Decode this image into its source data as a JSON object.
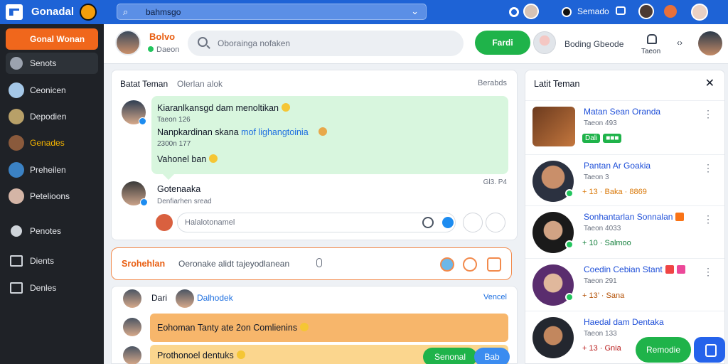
{
  "topbar": {
    "app_name": "Gonadal",
    "search_text": "bahmsgo",
    "user_label": "Semado"
  },
  "sidebar": {
    "items": [
      {
        "label": "Gonal Wonan"
      },
      {
        "label": "Senots"
      },
      {
        "label": "Ceonicen"
      },
      {
        "label": "Depodien"
      },
      {
        "label": "Genades"
      },
      {
        "label": "Preheilen"
      },
      {
        "label": "Petelioons"
      },
      {
        "label": "Penotes"
      },
      {
        "label": "Dients"
      },
      {
        "label": "Denles"
      }
    ]
  },
  "header": {
    "user_name": "Bolvo",
    "user_status": "Daeon",
    "search_placeholder": "Oborainga nofaken",
    "action_button": "Fardi",
    "contact_label": "Boding Gbeode",
    "lock_label": "Taeon",
    "more_label": "‹›"
  },
  "chat": {
    "title": "Batat Teman",
    "subtitle": "Olerlan alok",
    "right_label": "Berabds",
    "line1": "Kiaranlkansgd dam menoltikan",
    "line1_meta": "Taeon 126",
    "line2_prefix": "Nanpkardinan skana ",
    "line2_link": "mof lighangtoinia",
    "line2_meta": "2300n 177",
    "line3": "Vahonel ban",
    "time": "Gl3. P4",
    "user2_name": "Gotenaaka",
    "user2_sub": "Denfiarhen sread",
    "reply_placeholder": "Halalotonamel"
  },
  "compose": {
    "label": "Srohehlan",
    "placeholder": "Oeronake alidt tajeyodlanean"
  },
  "feed": {
    "label1": "Dari",
    "label2": "Dalhodek",
    "right_label": "Vencel",
    "bar1_text": "Eohoman Tanty ate 2on Comlienins",
    "bar2_text": "Prothonoel dentuks",
    "btn_green": "Senonal",
    "btn_blue": "Bab"
  },
  "friends_panel": {
    "title": "Latit Teman",
    "friends": [
      {
        "name": "Matan Sean Oranda",
        "sub": "Taeon 493",
        "stat": "Dali",
        "color": "#1fb34a"
      },
      {
        "name": "Pantan Ar Goakia",
        "sub": "Taeon 3",
        "stat": "+ 13  · Baka  · 8869",
        "color": "#f59e0b"
      },
      {
        "name": "Sonhantarlan Sonnalan",
        "sub": "Taeon 4033",
        "stat": "+ 10  · Salmoo",
        "color": "#1fb34a"
      },
      {
        "name": "Coedin Cebian Stant",
        "sub": "Taeon 291",
        "stat": "+ 13’  · Sana",
        "color": "#ef4444"
      },
      {
        "name": "Haedal dam Dentaka",
        "sub": "Taeon 133",
        "stat": "+ 13  · Gnia",
        "color": "#ef4444"
      }
    ],
    "fab_label": "Remodie"
  },
  "colors": {
    "brand_blue": "#1e63d6",
    "accent_orange": "#f0671c",
    "action_green": "#1fb34a"
  }
}
